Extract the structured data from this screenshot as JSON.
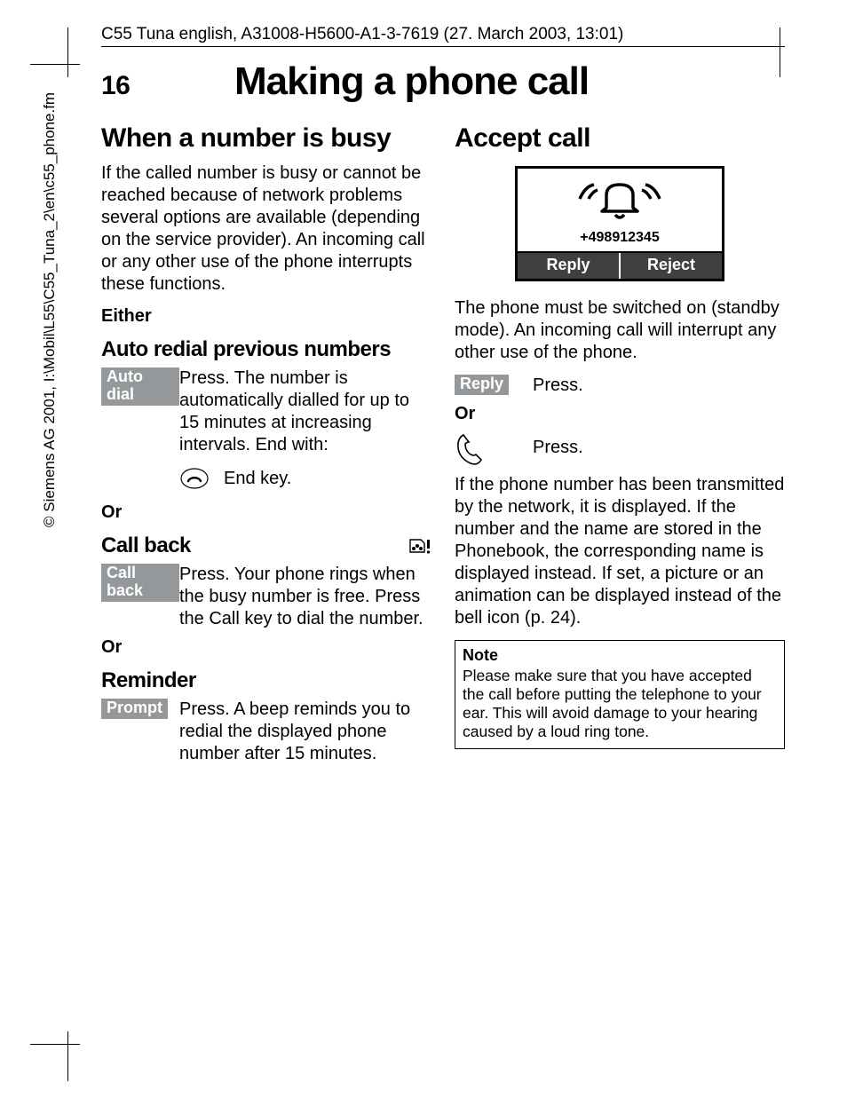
{
  "header": "C55 Tuna english, A31008-H5600-A1-3-7619 (27. March 2003, 13:01)",
  "sidebar_copyright": "© Siemens AG 2001, I:\\Mobil\\L55\\C55_Tuna_2\\en\\c55_phone.fm",
  "page_number": "16",
  "page_title": "Making a phone call",
  "left": {
    "h2": "When a number is busy",
    "intro": "If the called number is busy or cannot be reached because of network problems several options are available (depending on the service provider). An incoming call or any other use of the phone interrupts these functions.",
    "either_label": "Either",
    "h3_autoredial": "Auto redial previous numbers",
    "btn_autodial": "Auto dial",
    "autodial_text": "Press. The number is automatically dialled for up to 15 minutes at increasing intervals. End with:",
    "end_key": "End key.",
    "or1": "Or",
    "h3_callback": "Call back",
    "btn_callback": "Call back",
    "callback_text": "Press. Your phone rings when the busy number is free. Press the Call key to dial the number.",
    "or2": "Or",
    "h3_reminder": "Reminder",
    "btn_prompt": "Prompt",
    "prompt_text": "Press. A beep reminds you to redial the displayed phone number after 15 minutes."
  },
  "right": {
    "h2": "Accept call",
    "phone_number": "+498912345",
    "soft_reply": "Reply",
    "soft_reject": "Reject",
    "intro": "The phone must be switched on (standby mode). An incoming call will interrupt any other use of the phone.",
    "btn_reply": "Reply",
    "reply_press": "Press.",
    "or": "Or",
    "callkey_press": "Press.",
    "para2": "If the phone number has been transmitted by the network, it is displayed. If the number and the name are stored in the Phonebook, the corresponding name is displayed instead. If set, a picture or an animation can be displayed instead of the bell icon (p. 24).",
    "note_title": "Note",
    "note_body": "Please make sure that you have accepted the call before putting the telephone to your ear. This will avoid damage to your hearing caused by a loud ring tone."
  }
}
